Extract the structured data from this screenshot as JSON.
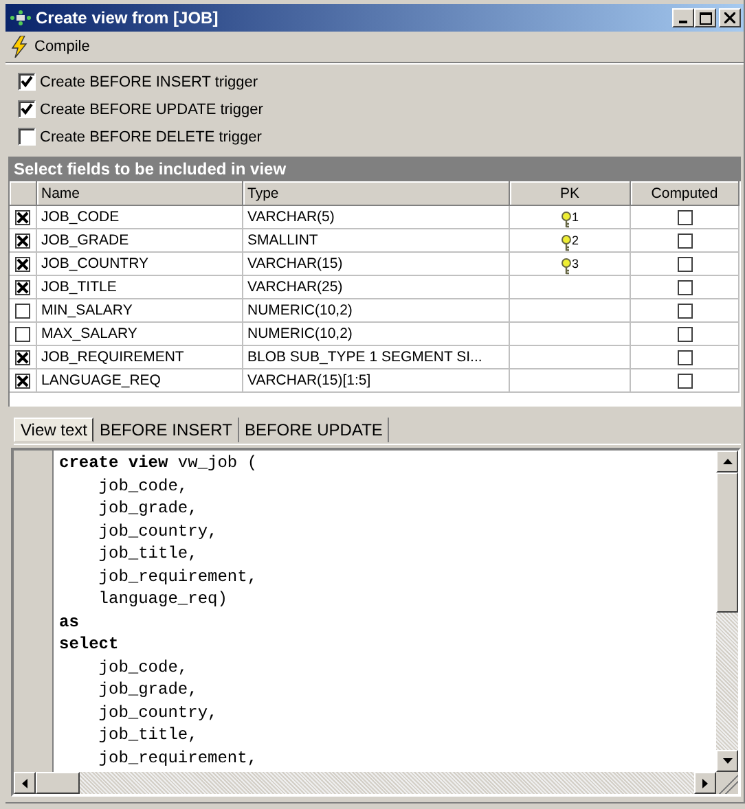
{
  "window": {
    "title": "Create view from [JOB]"
  },
  "toolbar": {
    "compile_label": "Compile"
  },
  "options": [
    {
      "label": "Create BEFORE INSERT trigger",
      "checked": true
    },
    {
      "label": "Create BEFORE UPDATE trigger",
      "checked": true
    },
    {
      "label": "Create BEFORE DELETE trigger",
      "checked": false
    }
  ],
  "fields_panel": {
    "title": "Select fields to be included in view"
  },
  "table": {
    "columns": [
      "Name",
      "Type",
      "PK",
      "Computed"
    ],
    "rows": [
      {
        "included": true,
        "name": "JOB_CODE",
        "type": "VARCHAR(5)",
        "pk": "1",
        "computed": false
      },
      {
        "included": true,
        "name": "JOB_GRADE",
        "type": "SMALLINT",
        "pk": "2",
        "computed": false
      },
      {
        "included": true,
        "name": "JOB_COUNTRY",
        "type": "VARCHAR(15)",
        "pk": "3",
        "computed": false
      },
      {
        "included": true,
        "name": "JOB_TITLE",
        "type": "VARCHAR(25)",
        "computed": false
      },
      {
        "included": false,
        "name": "MIN_SALARY",
        "type": "NUMERIC(10,2)",
        "computed": false
      },
      {
        "included": false,
        "name": "MAX_SALARY",
        "type": "NUMERIC(10,2)",
        "computed": false
      },
      {
        "included": true,
        "name": "JOB_REQUIREMENT",
        "type": "BLOB SUB_TYPE 1 SEGMENT SI...",
        "computed": false
      },
      {
        "included": true,
        "name": "LANGUAGE_REQ",
        "type": "VARCHAR(15)[1:5]",
        "computed": false
      }
    ]
  },
  "tabs": [
    {
      "label": "View text",
      "selected": true
    },
    {
      "label": "BEFORE INSERT",
      "selected": false
    },
    {
      "label": "BEFORE UPDATE",
      "selected": false
    }
  ],
  "editor": {
    "lines": [
      {
        "kind": "code",
        "text": "**create view** vw_job ("
      },
      {
        "kind": "code",
        "text": "    job_code,"
      },
      {
        "kind": "code",
        "text": "    job_grade,"
      },
      {
        "kind": "code",
        "text": "    job_country,"
      },
      {
        "kind": "code",
        "text": "    job_title,"
      },
      {
        "kind": "code",
        "text": "    job_requirement,"
      },
      {
        "kind": "code",
        "text": "    language_req)"
      },
      {
        "kind": "keyword",
        "text": "as"
      },
      {
        "kind": "keyword",
        "text": "select"
      },
      {
        "kind": "code",
        "text": "    job_code,"
      },
      {
        "kind": "code",
        "text": "    job_grade,"
      },
      {
        "kind": "code",
        "text": "    job_country,"
      },
      {
        "kind": "code",
        "text": "    job_title,"
      },
      {
        "kind": "code",
        "text": "    job_requirement,"
      }
    ]
  }
}
